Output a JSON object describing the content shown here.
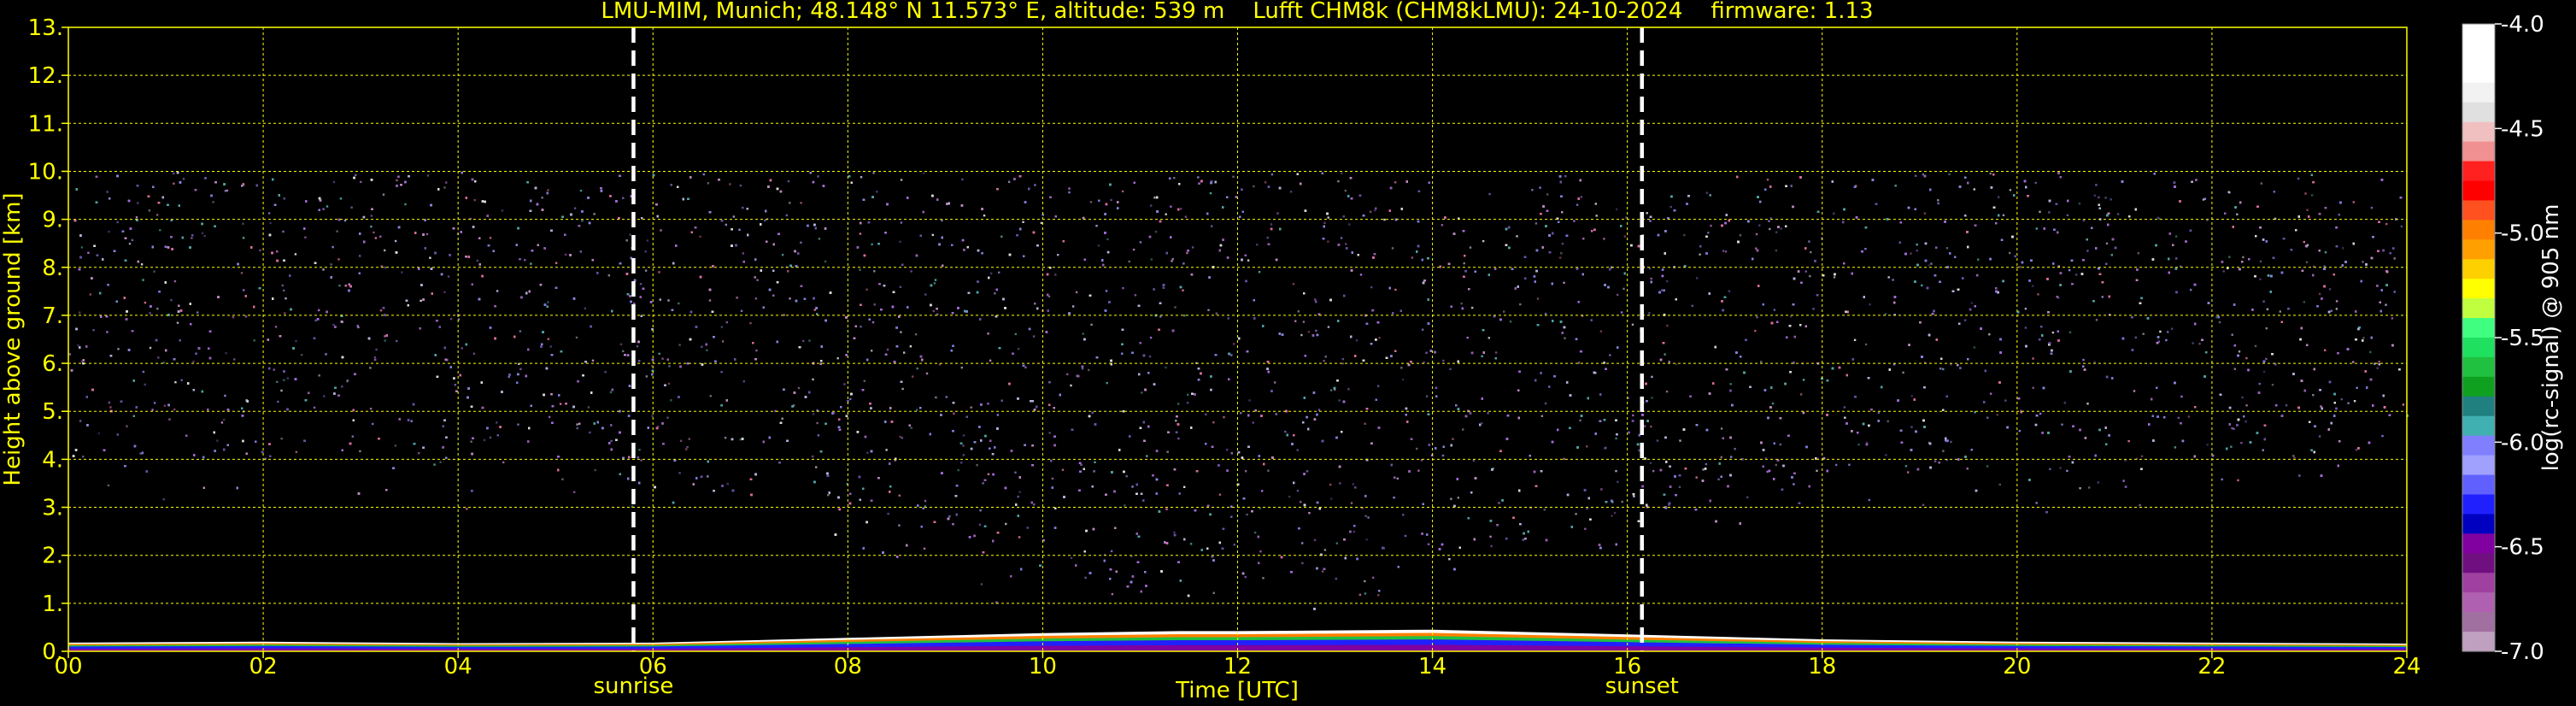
{
  "chart_data": {
    "type": "heatmap",
    "title": "LMU-MIM, Munich; 48.148° N 11.573° E, altitude: 539 m    Lufft CHM8k (CHM8kLMU): 24-10-2024    firmware: 1.13",
    "xlabel": "Time [UTC]",
    "ylabel": "Height above ground [km]",
    "xlim": [
      0,
      24
    ],
    "ylim": [
      0,
      13
    ],
    "x_ticks": [
      "00",
      "02",
      "04",
      "06",
      "08",
      "10",
      "12",
      "14",
      "16",
      "18",
      "20",
      "22",
      "24"
    ],
    "y_ticks": [
      "0.",
      "1.",
      "2.",
      "3.",
      "4.",
      "5.",
      "6.",
      "7.",
      "8.",
      "9.",
      "10.",
      "11.",
      "12.",
      "13."
    ],
    "grid": true,
    "signal_top_km": 10,
    "events": [
      {
        "label": "sunrise",
        "time_h": 5.8
      },
      {
        "label": "sunset",
        "time_h": 16.15
      }
    ],
    "surface_layer_km": [
      {
        "t": 0,
        "h": 0.18
      },
      {
        "t": 2,
        "h": 0.2
      },
      {
        "t": 4,
        "h": 0.17
      },
      {
        "t": 6,
        "h": 0.18
      },
      {
        "t": 8,
        "h": 0.28
      },
      {
        "t": 10,
        "h": 0.38
      },
      {
        "t": 11.4,
        "h": 0.42
      },
      {
        "t": 12,
        "h": 0.42
      },
      {
        "t": 14,
        "h": 0.45
      },
      {
        "t": 16,
        "h": 0.35
      },
      {
        "t": 18,
        "h": 0.25
      },
      {
        "t": 20,
        "h": 0.2
      },
      {
        "t": 22,
        "h": 0.18
      },
      {
        "t": 24,
        "h": 0.16
      }
    ],
    "colorbar": {
      "label": "log(rc-signal) @ 905 nm",
      "range": [
        -7.0,
        -4.0
      ],
      "ticks": [
        "-4.0",
        "-4.5",
        "-5.0",
        "-5.5",
        "-6.0",
        "-6.5",
        "-7.0"
      ],
      "colors": [
        "#ffffff",
        "#ffffff",
        "#ffffff",
        "#f2f2f2",
        "#e0e0e0",
        "#f0c0c0",
        "#f09090",
        "#ff2020",
        "#ff0000",
        "#ff5020",
        "#ff8000",
        "#ffa000",
        "#ffd000",
        "#ffff00",
        "#c0ff40",
        "#40ff80",
        "#20e060",
        "#20c040",
        "#10a020",
        "#208080",
        "#40b0b0",
        "#8080ff",
        "#a0a0ff",
        "#6060ff",
        "#2020ff",
        "#0000c0",
        "#8000a0",
        "#701080",
        "#a040a0",
        "#b060b0",
        "#a070a0",
        "#c0a0c0"
      ]
    }
  }
}
